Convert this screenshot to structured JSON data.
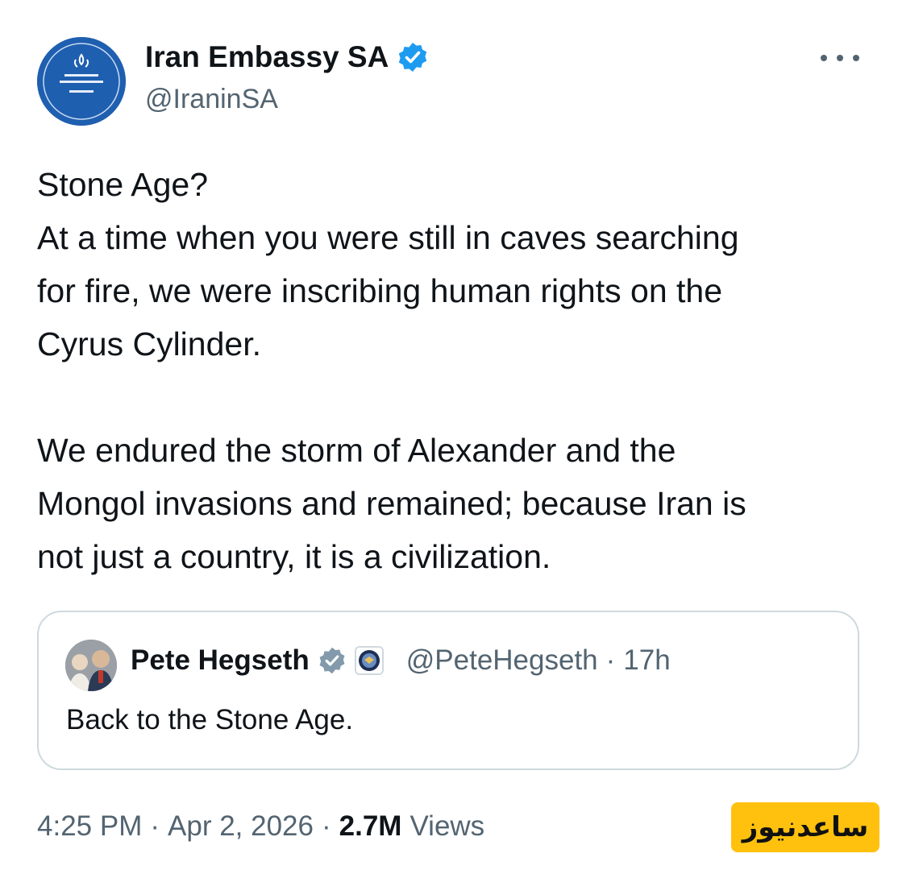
{
  "author": {
    "display_name": "Iran Embassy SA",
    "handle": "@IraninSA",
    "verified": true,
    "avatar_icon": "embassy-emblem-icon"
  },
  "more_icon": "more-dots-icon",
  "body_lines": [
    "Stone Age?",
    "At a time when you were still in caves searching",
    "for fire, we were inscribing human rights on the",
    "Cyrus Cylinder.",
    "",
    "We endured the storm of Alexander and the",
    "Mongol invasions and remained; because Iran is",
    "not just a country, it is a civilization."
  ],
  "quoted_post": {
    "display_name": "Pete Hegseth",
    "verified": true,
    "affiliation_icon": "department-of-defense-seal-icon",
    "handle": "@PeteHegseth",
    "separator": "·",
    "age": "17h",
    "text": "Back to the Stone Age."
  },
  "footer": {
    "time": "4:25 PM",
    "separator": "·",
    "date": "Apr 2, 2026",
    "views_count": "2.7M",
    "views_label": "Views"
  },
  "watermark": {
    "text": "ساعدنیوز"
  },
  "colors": {
    "text": "#0f1419",
    "secondary": "#536471",
    "verified_blue": "#1d9bf0",
    "verified_gray": "#829aab",
    "border": "#cfd9de",
    "watermark_bg": "#ffc10e"
  }
}
